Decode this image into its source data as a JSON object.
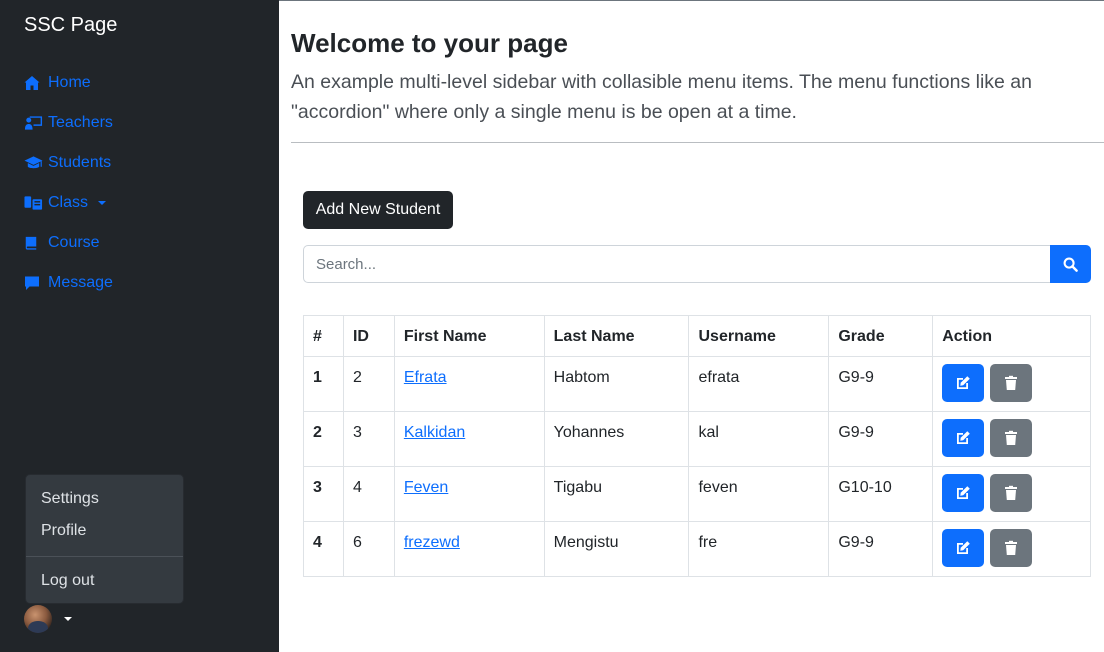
{
  "sidebar": {
    "brand": "SSC Page",
    "items": [
      {
        "label": "Home",
        "icon": "home-icon"
      },
      {
        "label": "Teachers",
        "icon": "chalkboard-teacher-icon"
      },
      {
        "label": "Students",
        "icon": "graduation-cap-icon"
      },
      {
        "label": "Class",
        "icon": "class-icon"
      },
      {
        "label": "Course",
        "icon": "book-icon"
      },
      {
        "label": "Message",
        "icon": "comment-icon"
      }
    ],
    "user_menu": {
      "settings": "Settings",
      "profile": "Profile",
      "logout": "Log out"
    }
  },
  "header": {
    "title": "Welcome to your page",
    "lead": "An example multi-level sidebar with collasible menu items. The menu functions like an \"accordion\" where only a single menu is be open at a time."
  },
  "toolbar": {
    "add_label": "Add New Student"
  },
  "search": {
    "placeholder": "Search...",
    "value": ""
  },
  "table": {
    "headers": [
      "#",
      "ID",
      "First Name",
      "Last Name",
      "Username",
      "Grade",
      "Action"
    ],
    "rows": [
      {
        "num": "1",
        "id": "2",
        "first": "Efrata",
        "last": "Habtom",
        "username": "efrata",
        "grade": "G9-9"
      },
      {
        "num": "2",
        "id": "3",
        "first": "Kalkidan",
        "last": "Yohannes",
        "username": "kal",
        "grade": "G9-9"
      },
      {
        "num": "3",
        "id": "4",
        "first": "Feven",
        "last": "Tigabu",
        "username": "feven",
        "grade": "G10-10"
      },
      {
        "num": "4",
        "id": "6",
        "first": "frezewd",
        "last": "Mengistu",
        "username": "fre",
        "grade": "G9-9"
      }
    ]
  },
  "colors": {
    "sidebar_bg": "#212529",
    "primary": "#0d6efd",
    "secondary": "#6c757d",
    "dropdown_bg": "#343a40"
  }
}
